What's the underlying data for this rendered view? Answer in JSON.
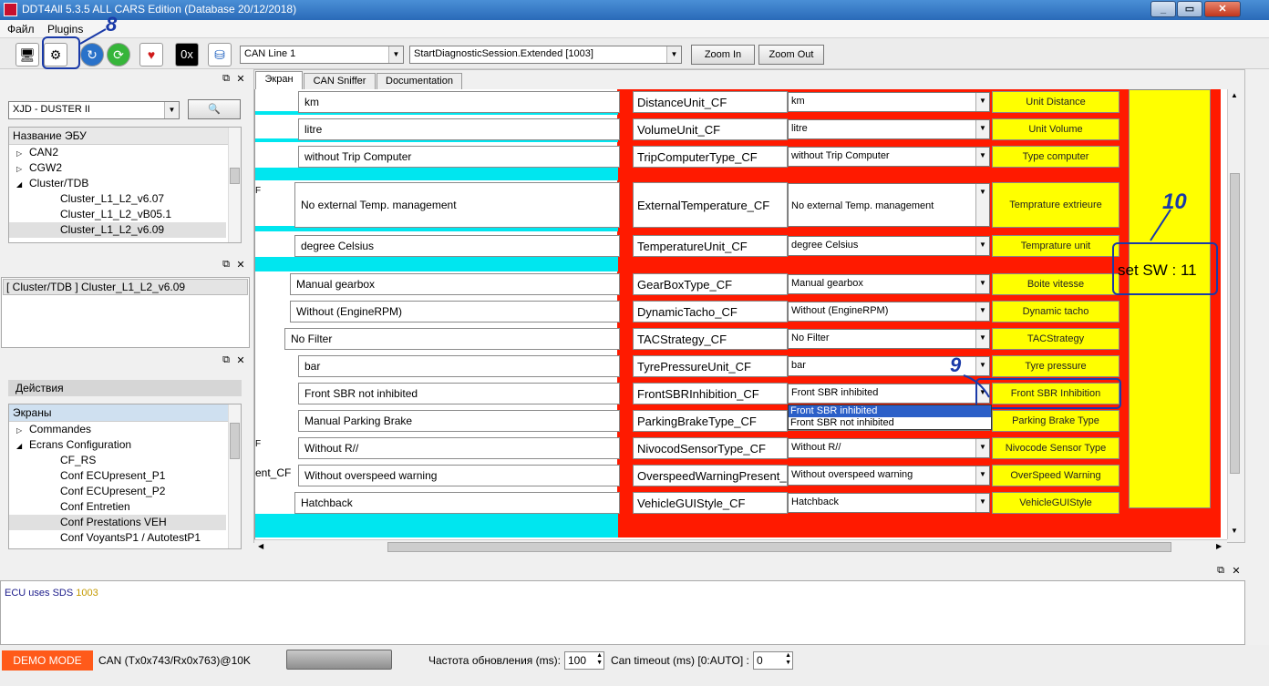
{
  "window": {
    "title": "DDT4All 5.3.5 ALL CARS Edition (Database 20/12/2018)"
  },
  "menu": {
    "file": "Файл",
    "plugins": "Plugins"
  },
  "toolbar": {
    "hex_icon_label": "0x",
    "can_line": "CAN Line 1",
    "session": "StartDiagnosticSession.Extended [1003]",
    "zoom_in": "Zoom In",
    "zoom_out": "Zoom Out"
  },
  "left": {
    "vehicle_combo": "XJD - DUSTER II",
    "ecu_header": "Название ЭБУ",
    "ecu_tree": [
      {
        "label": "CAN2",
        "expander": "▷"
      },
      {
        "label": "CGW2",
        "expander": "▷"
      },
      {
        "label": "Cluster/TDB",
        "expander": "◢"
      },
      {
        "label": "Cluster_L1_L2_v6.07",
        "expander": ""
      },
      {
        "label": "Cluster_L1_L2_vB05.1",
        "expander": ""
      },
      {
        "label": "Cluster_L1_L2_v6.09",
        "expander": ""
      }
    ],
    "selected_ecu": "[ Cluster/TDB ] Cluster_L1_L2_v6.09",
    "actions_header": "Действия",
    "screens_header": "Экраны",
    "screens_tree": [
      {
        "label": "Commandes",
        "expander": "▷"
      },
      {
        "label": "Ecrans Configuration",
        "expander": "◢"
      },
      {
        "label": "CF_RS",
        "expander": ""
      },
      {
        "label": "Conf ECUpresent_P1",
        "expander": ""
      },
      {
        "label": "Conf ECUpresent_P2",
        "expander": ""
      },
      {
        "label": "Conf Entretien",
        "expander": ""
      },
      {
        "label": "Conf Prestations VEH",
        "expander": ""
      },
      {
        "label": "Conf VoyantsP1 / AutotestP1",
        "expander": ""
      }
    ]
  },
  "tabs": [
    "Экран",
    "CAN Sniffer",
    "Documentation"
  ],
  "params": [
    {
      "left_value": "km",
      "name": "DistanceUnit_CF",
      "selected": "km",
      "button": "Unit Distance"
    },
    {
      "left_value": "litre",
      "name": "VolumeUnit_CF",
      "selected": "litre",
      "button": "Unit Volume"
    },
    {
      "left_value": "without Trip Computer",
      "name": "TripComputerType_CF",
      "selected": "without Trip Computer",
      "button": "Type computer"
    },
    {
      "left_value": "No external Temp. management",
      "name": "ExternalTemperature_CF",
      "selected": "No external Temp. management",
      "button": "Temprature extrieure"
    },
    {
      "left_value": "degree Celsius",
      "name": "TemperatureUnit_CF",
      "selected": "degree Celsius",
      "button": "Temprature unit"
    },
    {
      "left_value": "Manual gearbox",
      "name": "GearBoxType_CF",
      "selected": "Manual gearbox",
      "button": "Boite vitesse"
    },
    {
      "left_value": "Without (EngineRPM)",
      "name": "DynamicTacho_CF",
      "selected": "Without (EngineRPM)",
      "button": "Dynamic tacho"
    },
    {
      "left_value": "No Filter",
      "name": "TACStrategy_CF",
      "selected": "No Filter",
      "button": "TACStrategy"
    },
    {
      "left_value": "bar",
      "name": "TyrePressureUnit_CF",
      "selected": "bar",
      "button": "Tyre pressure"
    },
    {
      "left_value": "Front SBR not inhibited",
      "name": "FrontSBRInhibition_CF",
      "selected": "Front SBR inhibited",
      "button": "Front SBR Inhibition"
    },
    {
      "left_value": "Manual Parking Brake",
      "name": "ParkingBrakeType_CF",
      "selected": "",
      "button": "Parking Brake Type"
    },
    {
      "left_value": "Without R//",
      "name": "NivocodSensorType_CF",
      "selected": "Without R//",
      "button": "Nivocode Sensor Type"
    },
    {
      "left_value": "Without overspeed warning",
      "name": "OverspeedWarningPresent_C",
      "selected": "Without overspeed warning",
      "button": "OverSpeed Warning"
    },
    {
      "left_value": "Hatchback",
      "name": "VehicleGUIStyle_CF",
      "selected": "Hatchback",
      "button": "VehicleGUIStyle"
    }
  ],
  "dropdown_open": {
    "options": [
      "Front SBR inhibited",
      "Front SBR not inhibited"
    ],
    "highlighted": "Front SBR inhibited"
  },
  "left_edge_fragments": {
    "overspeed": "ent_CF",
    "marker": "F"
  },
  "yellow_panel_text": "set SW : 11",
  "annotations": {
    "eight": "8",
    "nine": "9",
    "ten": "10"
  },
  "log": {
    "prefix": "ECU uses SDS",
    "code": "1003",
    "code_color": "#c49a00"
  },
  "status": {
    "demo_mode": "DEMO MODE",
    "can_info": "CAN (Tx0x743/Rx0x763)@10K",
    "refresh_label": "Частота обновления (ms):",
    "refresh_value": "100",
    "timeout_label": "Can timeout (ms) [0:AUTO] :",
    "timeout_value": "0"
  },
  "colors": {
    "accent_red": "#ff1a00",
    "cyan": "#00e6ef",
    "yellow": "#ffff00",
    "annotation_blue": "#1a3aa8",
    "demo_bg": "#ff5a1a"
  }
}
